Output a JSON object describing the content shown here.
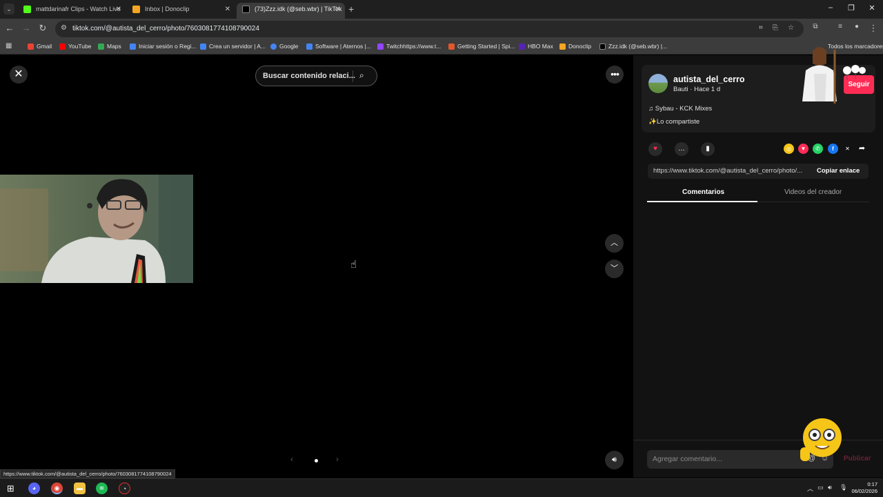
{
  "browser": {
    "tabs": [
      {
        "title": "mattdarinafr Clips - Watch Live",
        "favicon_color": "#53fc18",
        "active": false
      },
      {
        "title": "Inbox | Donoclip",
        "favicon_color": "#f5a623",
        "active": false
      },
      {
        "title": "(73)Zzz.idk (@seb.wbr) | TikTok",
        "favicon_color": "#000000",
        "active": true
      }
    ],
    "url": "tiktok.com/@autista_del_cerro/photo/7603081774108790024",
    "bookmarks": [
      {
        "label": "Gmail",
        "color": "#ea4335"
      },
      {
        "label": "YouTube",
        "color": "#ff0000"
      },
      {
        "label": "Maps",
        "color": "#34a853"
      },
      {
        "label": "Iniciar sesión o Regi...",
        "color": "#4285f4"
      },
      {
        "label": "Crea un servidor | A...",
        "color": "#4285f4"
      },
      {
        "label": "Google",
        "color": "#4285f4"
      },
      {
        "label": "Software | Aternos |...",
        "color": "#4285f4"
      },
      {
        "label": "Twitchhttps://www.t...",
        "color": "#9146ff"
      },
      {
        "label": "Getting Started | Spi...",
        "color": "#e3572b"
      },
      {
        "label": "HBO Max",
        "color": "#5822b4"
      },
      {
        "label": "Donoclip",
        "color": "#f5a623"
      },
      {
        "label": "Zzz.idk (@seb.wbr) |...",
        "color": "#000000"
      }
    ],
    "all_bookmarks_label": "Todos los marcadores",
    "status_url": "https://www.tiktok.com/@autista_del_cerro/photo/7603081774108790024"
  },
  "viewer": {
    "search_placeholder": "Buscar contenido relaci...",
    "close_icon": "✕",
    "more_icon": "•••",
    "prev_icon": "‹",
    "next_icon": "›"
  },
  "panel": {
    "username": "autista_del_cerro",
    "subline": "Bauti · Hace 1 d",
    "music": "Sybau - KCK Mixes",
    "shared": "Lo compartiste",
    "follow_label": "Seguir",
    "link": "https://www.tiktok.com/@autista_del_cerro/photo/...",
    "copy_link": "Copiar enlace",
    "tab_comments": "Comentarios",
    "tab_creator_videos": "Videos del creador",
    "comment_placeholder": "Agregar comentario...",
    "post_label": "Publicar",
    "accent": "#fe2c55"
  },
  "taskbar": {
    "time": "0:17",
    "date": "06/02/2026"
  }
}
